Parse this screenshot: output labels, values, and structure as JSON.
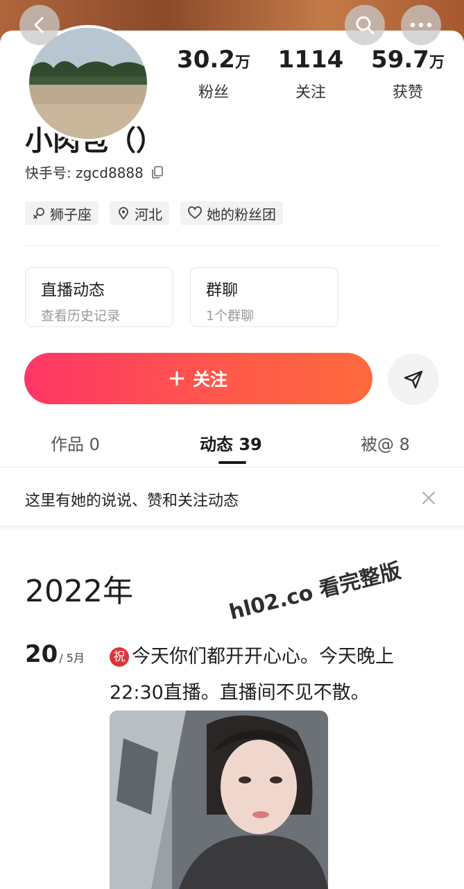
{
  "header": {
    "back_icon": "chevron-left-icon",
    "search_icon": "search-icon",
    "more_icon": "more-horizontal-icon"
  },
  "stats": [
    {
      "number": "30.2",
      "unit": "万",
      "label": "粉丝"
    },
    {
      "number": "1114",
      "unit": "",
      "label": "关注"
    },
    {
      "number": "59.7",
      "unit": "万",
      "label": "获赞"
    }
  ],
  "profile": {
    "name": "小肉包（）",
    "id_text": "快手号: zgcd8888",
    "tags": [
      {
        "icon": "zodiac-icon",
        "label": "狮子座"
      },
      {
        "icon": "location-pin-icon",
        "label": "河北"
      },
      {
        "icon": "heart-icon",
        "label": "她的粉丝团"
      }
    ]
  },
  "boxes": [
    {
      "title": "直播动态",
      "subtitle": "查看历史记录"
    },
    {
      "title": "群聊",
      "subtitle": "1个群聊"
    }
  ],
  "actions": {
    "follow_label": "关注",
    "accent_gradient": [
      "#fe3666",
      "#ff6a3d"
    ]
  },
  "tabs": [
    {
      "label": "作品 0"
    },
    {
      "label": "动态 39",
      "active": true
    },
    {
      "label": "被@ 8"
    }
  ],
  "notice": {
    "text": "这里有她的说说、赞和关注动态"
  },
  "feed": {
    "year": "2022年",
    "day": "20",
    "month": "/ 5月",
    "badge": "祝",
    "post_text": "今天你们都开开心心。今天晚上22:30直播。直播间不见不散。"
  },
  "watermark": "hl02.co 看完整版"
}
